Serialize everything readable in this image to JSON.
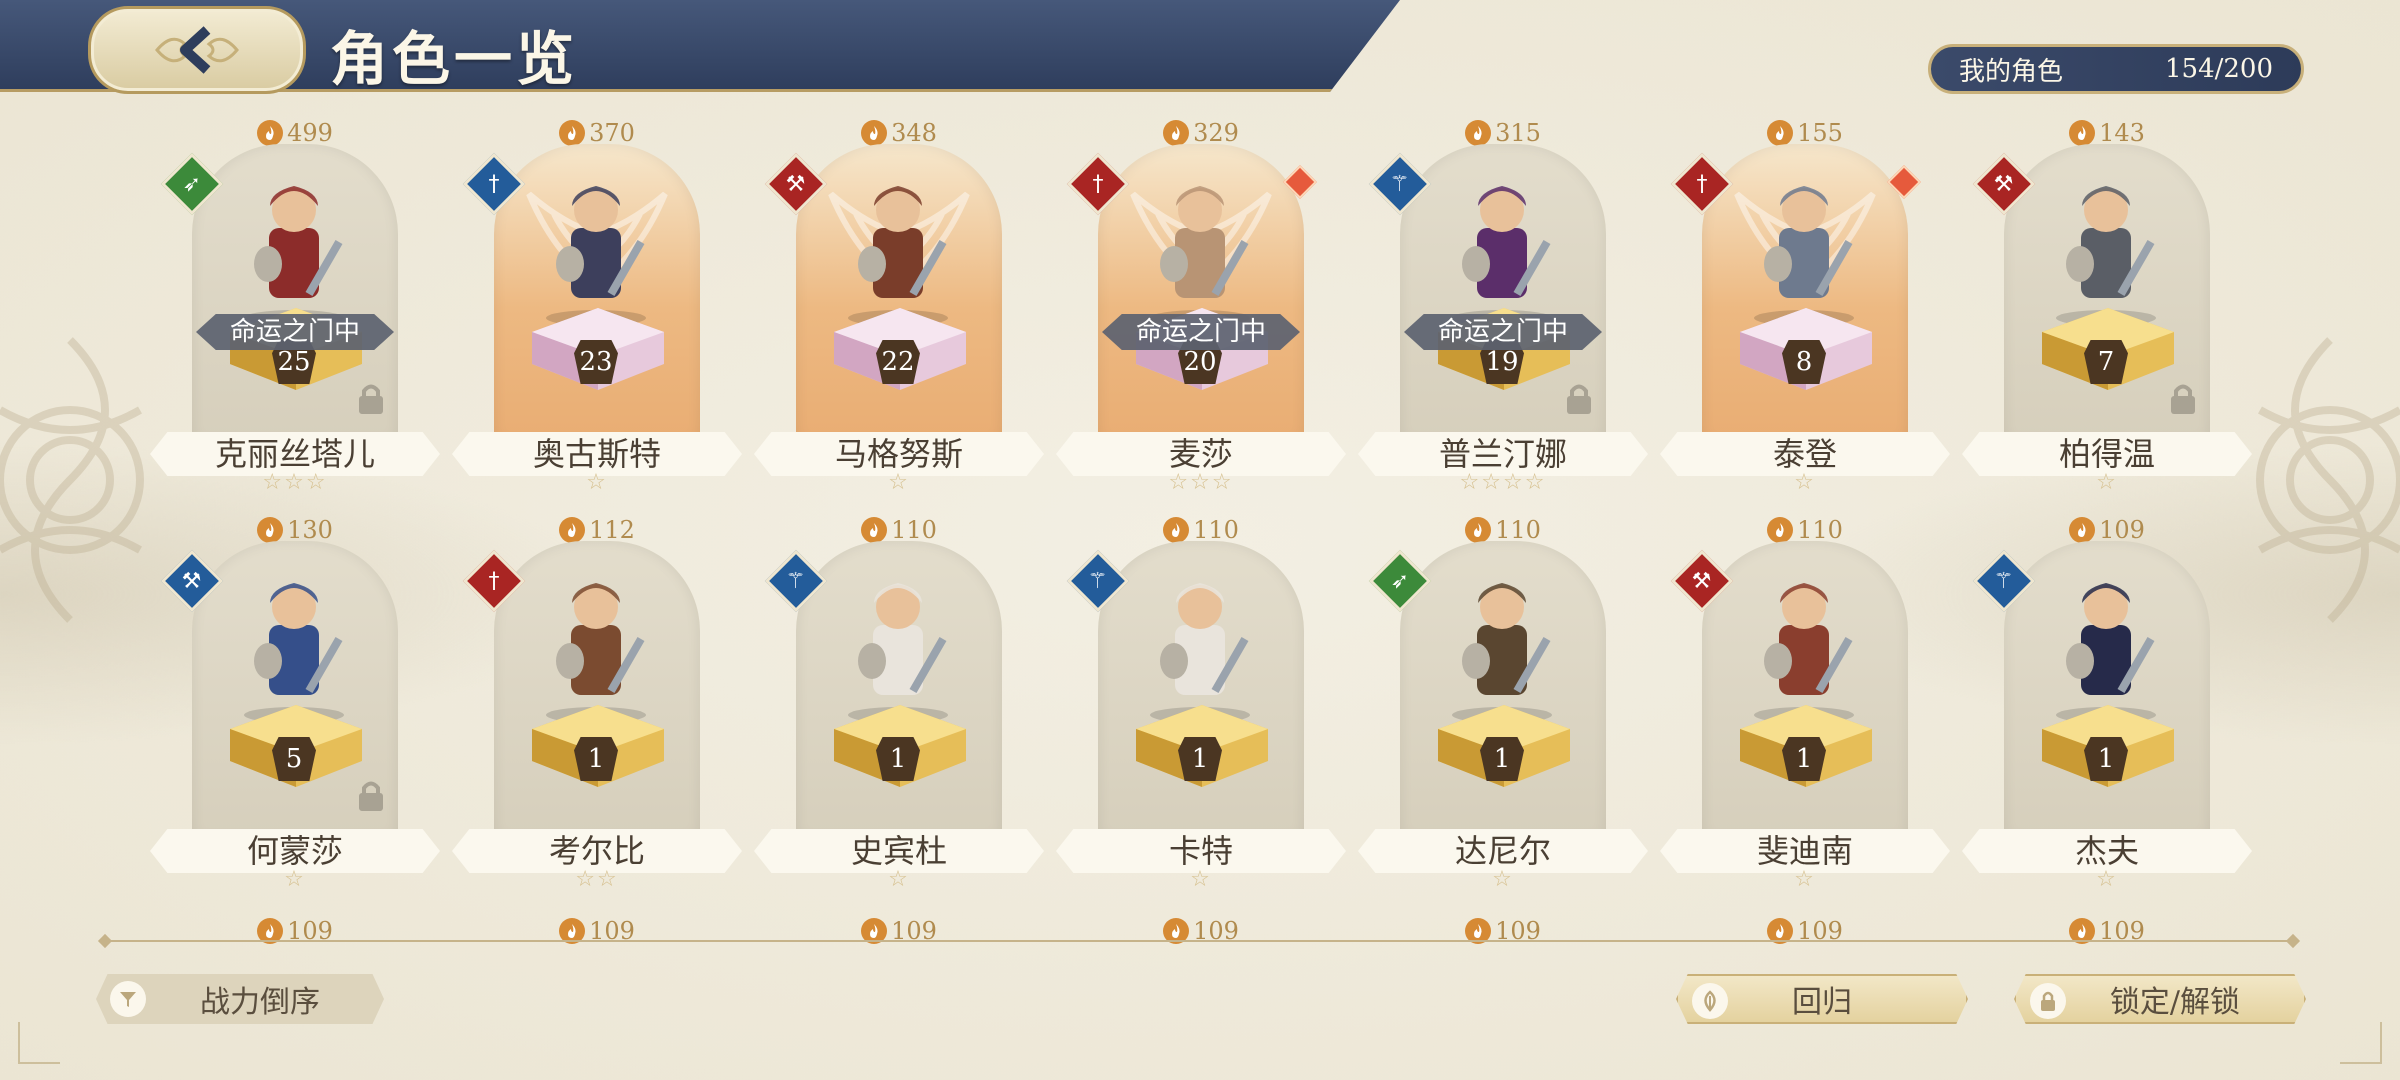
{
  "header": {
    "title": "角色一览"
  },
  "my_characters": {
    "label": "我的角色",
    "count": "154/200"
  },
  "rows": [
    [
      {
        "power": "499",
        "name": "克丽丝塔儿",
        "level": "25",
        "stars": "☆☆☆",
        "destiny": "命运之门中",
        "locked": true,
        "class": "green",
        "class_icon": "bow-icon",
        "gold": false,
        "star_badge": false,
        "hero_color": "#8c2c2a"
      },
      {
        "power": "370",
        "name": "奥古斯特",
        "level": "23",
        "stars": "☆",
        "destiny": "",
        "locked": false,
        "class": "blue",
        "class_icon": "sword-icon",
        "gold": true,
        "star_badge": false,
        "hero_color": "#3d3f5c"
      },
      {
        "power": "348",
        "name": "马格努斯",
        "level": "22",
        "stars": "☆",
        "destiny": "",
        "locked": false,
        "class": "red",
        "class_icon": "axe-icon",
        "gold": true,
        "star_badge": false,
        "hero_color": "#7a3d2a"
      },
      {
        "power": "329",
        "name": "麦莎",
        "level": "20",
        "stars": "☆☆☆",
        "destiny": "命运之门中",
        "locked": false,
        "class": "red",
        "class_icon": "sword-icon",
        "gold": true,
        "star_badge": true,
        "hero_color": "#b89474"
      },
      {
        "power": "315",
        "name": "普兰汀娜",
        "level": "19",
        "stars": "☆☆☆☆",
        "destiny": "命运之门中",
        "locked": true,
        "class": "blue",
        "class_icon": "staff-icon",
        "gold": false,
        "star_badge": false,
        "hero_color": "#5b2e6a"
      },
      {
        "power": "155",
        "name": "泰登",
        "level": "8",
        "stars": "☆",
        "destiny": "",
        "locked": false,
        "class": "red",
        "class_icon": "sword-icon",
        "gold": true,
        "star_badge": true,
        "hero_color": "#6e7a8e"
      },
      {
        "power": "143",
        "name": "柏得温",
        "level": "7",
        "stars": "☆",
        "destiny": "",
        "locked": true,
        "class": "red",
        "class_icon": "axe-icon",
        "gold": false,
        "star_badge": false,
        "hero_color": "#5a5e66"
      }
    ],
    [
      {
        "power": "130",
        "name": "何蒙莎",
        "level": "5",
        "stars": "☆",
        "destiny": "",
        "locked": true,
        "class": "blue",
        "class_icon": "hammer-icon",
        "gold": false,
        "star_badge": false,
        "hero_color": "#354f8a"
      },
      {
        "power": "112",
        "name": "考尔比",
        "level": "1",
        "stars": "☆☆",
        "destiny": "",
        "locked": false,
        "class": "red",
        "class_icon": "sword-icon",
        "gold": false,
        "star_badge": false,
        "hero_color": "#7b4b30"
      },
      {
        "power": "110",
        "name": "史宾杜",
        "level": "1",
        "stars": "☆",
        "destiny": "",
        "locked": false,
        "class": "blue",
        "class_icon": "staff-icon",
        "gold": false,
        "star_badge": false,
        "hero_color": "#e9e4dc"
      },
      {
        "power": "110",
        "name": "卡特",
        "level": "1",
        "stars": "☆",
        "destiny": "",
        "locked": false,
        "class": "blue",
        "class_icon": "staff-icon",
        "gold": false,
        "star_badge": false,
        "hero_color": "#e9e4dc"
      },
      {
        "power": "110",
        "name": "达尼尔",
        "level": "1",
        "stars": "☆",
        "destiny": "",
        "locked": false,
        "class": "green",
        "class_icon": "bow-icon",
        "gold": false,
        "star_badge": false,
        "hero_color": "#5a4630"
      },
      {
        "power": "110",
        "name": "斐迪南",
        "level": "1",
        "stars": "☆",
        "destiny": "",
        "locked": false,
        "class": "red",
        "class_icon": "axe-icon",
        "gold": false,
        "star_badge": false,
        "hero_color": "#8a3e2e"
      },
      {
        "power": "109",
        "name": "杰夫",
        "level": "1",
        "stars": "☆",
        "destiny": "",
        "locked": false,
        "class": "blue",
        "class_icon": "staff-icon",
        "gold": false,
        "star_badge": false,
        "hero_color": "#262a4a"
      }
    ]
  ],
  "row3_powers": [
    "109",
    "109",
    "109",
    "109",
    "109",
    "109",
    "109"
  ],
  "buttons": {
    "sort": "战力倒序",
    "return": "回归",
    "lock": "锁定/解锁"
  },
  "colors": {
    "header": "#2e3d5c",
    "gold": "#b08b4e",
    "class_green": "#3c8a3a",
    "class_blue": "#235c9a",
    "class_red": "#a92523"
  }
}
